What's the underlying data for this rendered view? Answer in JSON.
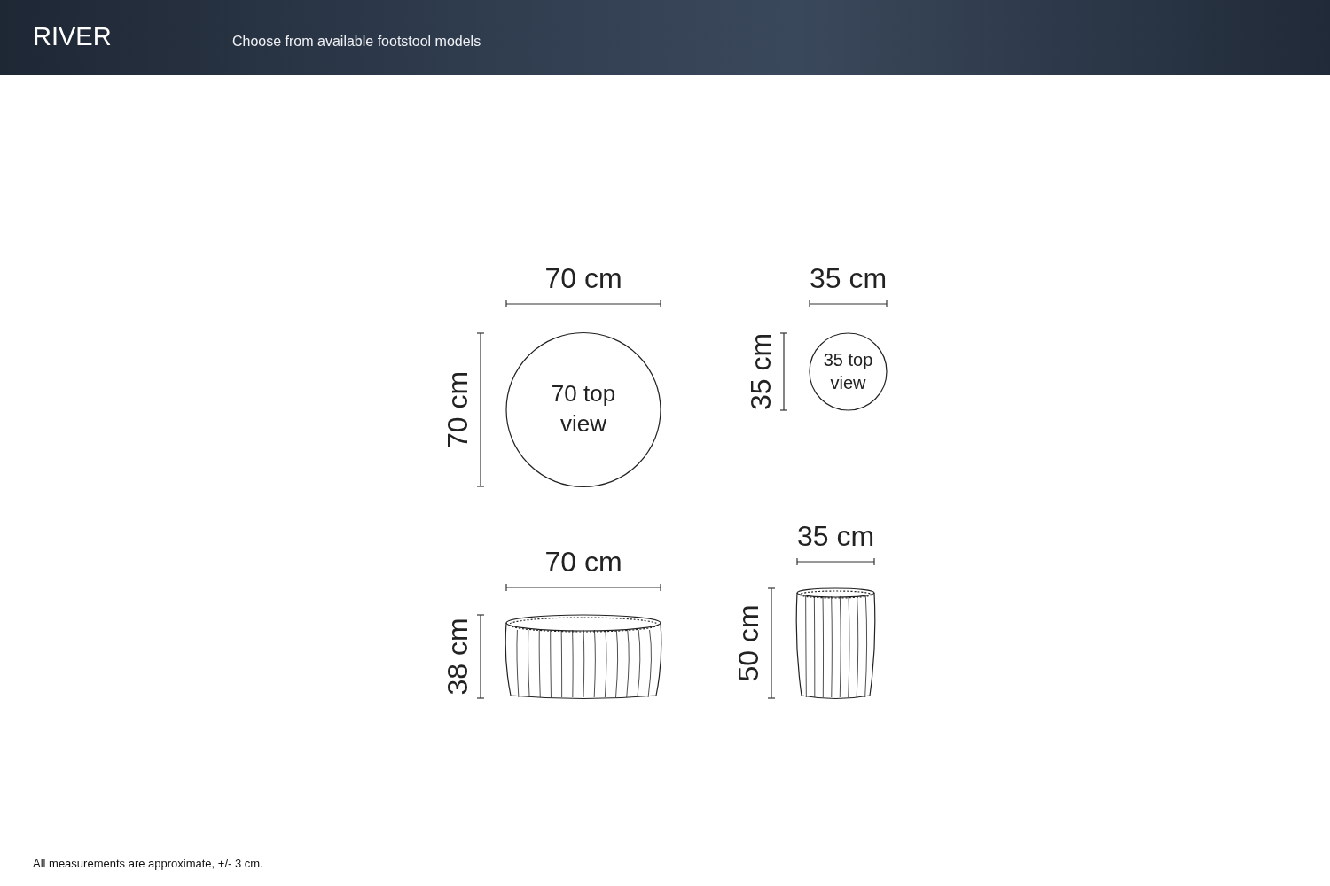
{
  "header": {
    "title": "RIVER",
    "subtitle": "Choose from available footstool models"
  },
  "drawings": [
    {
      "kind": "top",
      "width_label": "70 cm",
      "height_label": "70 cm",
      "view_label": [
        "70 top",
        "view"
      ]
    },
    {
      "kind": "top",
      "width_label": "35 cm",
      "height_label": "35 cm",
      "view_label": [
        "35 top",
        "view"
      ]
    },
    {
      "kind": "side",
      "width_label": "70 cm",
      "height_label": "38 cm"
    },
    {
      "kind": "side",
      "width_label": "35 cm",
      "height_label": "50 cm"
    }
  ],
  "footnote": "All measurements are approximate, +/- 3 cm."
}
